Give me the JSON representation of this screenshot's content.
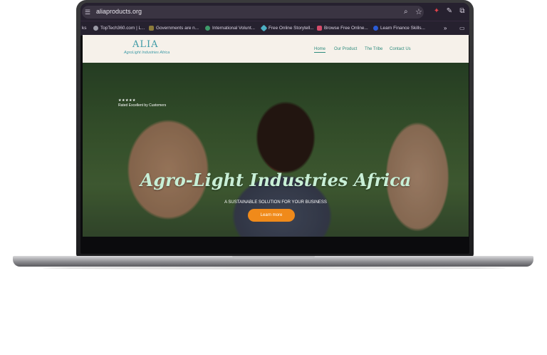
{
  "browser": {
    "url": "aliaproducts.org",
    "bookmarks": [
      {
        "label": "ks",
        "color": "#26212f"
      },
      {
        "label": "TopTech360.com | L...",
        "color": "#9a9aa6"
      },
      {
        "label": "Governments are n...",
        "color": "#8b7a3a"
      },
      {
        "label": "International Volunt...",
        "color": "#3e9a6a"
      },
      {
        "label": "Free Online Storytell...",
        "color": "#4db0c4"
      },
      {
        "label": "Browse Free Online...",
        "color": "#d44b6a"
      },
      {
        "label": "Learn Finance Skills...",
        "color": "#2a5bd7"
      }
    ],
    "more": "»"
  },
  "site": {
    "logo": "ALIA",
    "logo_sub": "AgroLight Industries Africa",
    "nav": [
      "Home",
      "Our Product",
      "The Tribe",
      "Contact Us"
    ],
    "active_nav": "Home",
    "rating_stars": "★★★★★",
    "rating_text": "Rated Excellent by Customers",
    "hero_title": "Agro-Light Industries Africa",
    "hero_sub": "A SUSTAINABLE SOLUTION FOR YOUR BUSINESS",
    "cta": "Learn more",
    "accent": "#f08a1a",
    "brand": "#2f8c7e"
  }
}
